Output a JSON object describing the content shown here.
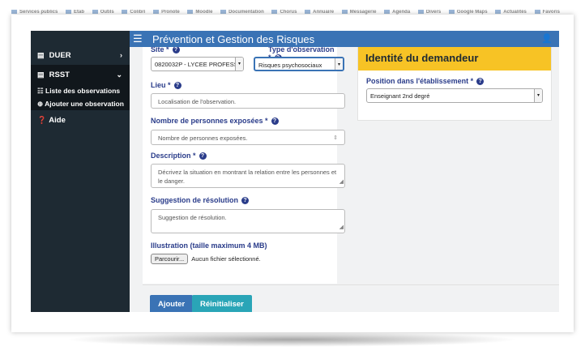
{
  "bookmarks": [
    "Services publics",
    "Etab",
    "Outils",
    "Colibri",
    "Pronote",
    "Moodle",
    "Documentation",
    "Chorus",
    "Annuaire",
    "Messagerie",
    "Agenda",
    "Divers",
    "Google Maps",
    "Actualités",
    "Favoris"
  ],
  "topbar": {
    "title": "Prévention et Gestion des Risques",
    "menu_icon": "☰",
    "user_icon": "👤"
  },
  "sidebar": {
    "items": [
      {
        "label": "DUER",
        "icon": "▤",
        "arrow": "›"
      },
      {
        "label": "RSST",
        "icon": "▤",
        "arrow": "⌄"
      }
    ],
    "subitems": [
      {
        "label": "Liste des observations",
        "icon": "☷"
      },
      {
        "label": "Ajouter une observation",
        "icon": "⊕"
      }
    ],
    "help": {
      "label": "Aide",
      "icon": "❓"
    }
  },
  "form": {
    "site_label": "Site *",
    "site_value": "0820032P - LYCEE PROFESS",
    "type_label": "Type d'observation *",
    "type_value": "Risques psychosociaux",
    "lieu_label": "Lieu *",
    "lieu_placeholder": "Localisation de l'observation.",
    "persons_label": "Nombre de personnes exposées *",
    "persons_placeholder": "Nombre de personnes exposées.",
    "description_label": "Description *",
    "description_placeholder": "Décrivez la situation en montrant la relation entre les personnes et le danger.",
    "suggestion_label": "Suggestion de résolution",
    "suggestion_placeholder": "Suggestion de résolution.",
    "illustration_label": "Illustration (taille maximum 4 MB)",
    "browse_label": "Parcourir...",
    "no_file_label": "Aucun fichier sélectionné.",
    "submit_label": "Ajouter",
    "reset_label": "Réinitialiser"
  },
  "identity": {
    "title": "Identité du demandeur",
    "position_label": "Position dans l'établissement *",
    "position_value": "Enseignant 2nd degré"
  },
  "colors": {
    "sidebar": "#1e2a33",
    "topbar": "#3a73b5",
    "identity_header": "#f7c325",
    "submit": "#3a73b5",
    "reset": "#2aa5b7",
    "label": "#2a3c8a"
  }
}
